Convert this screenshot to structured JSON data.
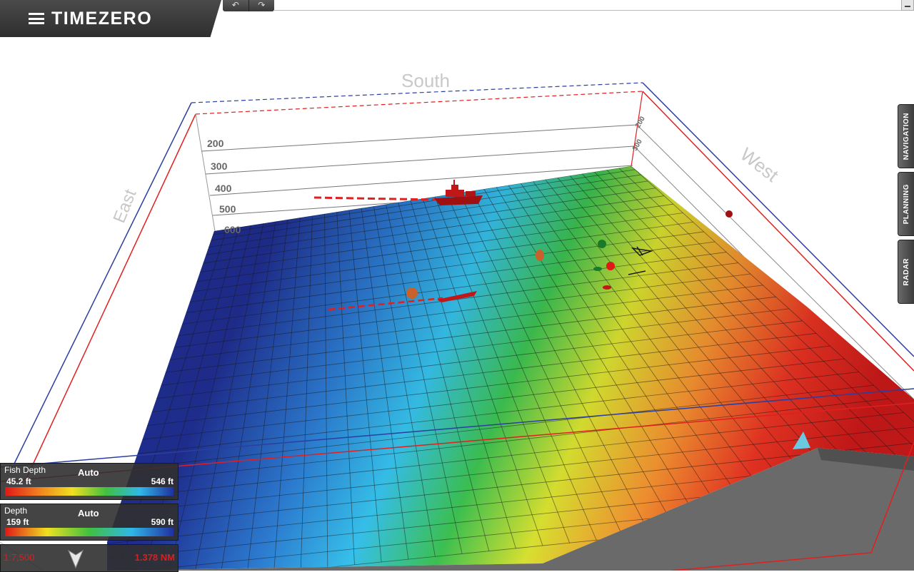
{
  "app": {
    "title": "TIMEZERO"
  },
  "toolbar": {
    "undo_icon": "undo-icon",
    "redo_icon": "redo-icon",
    "undo_glyph": "↶",
    "redo_glyph": "↷"
  },
  "scene": {
    "directions": {
      "south": "South",
      "west": "West",
      "east": "East"
    },
    "depth_scale_left": [
      "200",
      "300",
      "400",
      "500",
      "600"
    ],
    "depth_scale_right": [
      "200",
      "300"
    ]
  },
  "side_tabs": [
    {
      "label": "NAVIGATION"
    },
    {
      "label": "PLANNING"
    },
    {
      "label": "RADAR"
    }
  ],
  "legends": {
    "fish_depth": {
      "title": "Fish Depth",
      "mode": "Auto",
      "min": "45.2 ft",
      "max": "546 ft"
    },
    "depth": {
      "title": "Depth",
      "mode": "Auto",
      "min": "159 ft",
      "max": "590 ft"
    }
  },
  "scale": {
    "ratio": "1:7,500",
    "distance": "1.378 NM",
    "north_icon": "north-arrow-icon"
  },
  "colors": {
    "accent_red": "#d62020",
    "boundary_blue": "#2a3fa0",
    "boundary_red": "#e02020",
    "panel_bg": "#303030",
    "depth_gradient": [
      "#e01818",
      "#f08020",
      "#f0e020",
      "#40c040",
      "#30b8e8",
      "#2030a0"
    ]
  }
}
